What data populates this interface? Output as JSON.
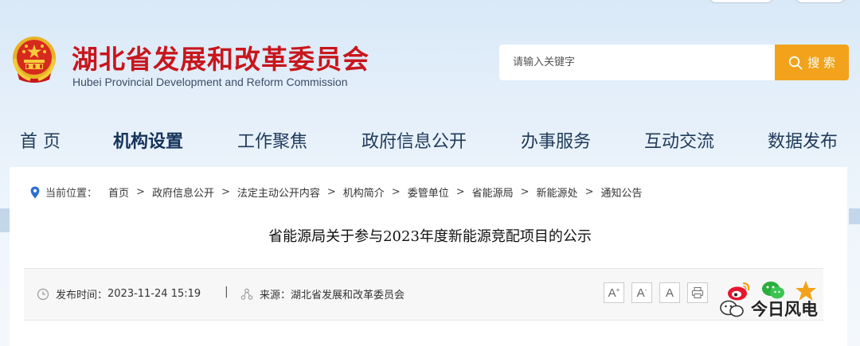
{
  "header": {
    "title_cn": "湖北省发展和改革委员会",
    "title_en": "Hubei Provincial Development and Reform Commission"
  },
  "search": {
    "placeholder": "请输入关键字",
    "button_label": "搜 索"
  },
  "nav": {
    "items": [
      {
        "label": "首 页"
      },
      {
        "label": "机构设置"
      },
      {
        "label": "工作聚焦"
      },
      {
        "label": "政府信息公开"
      },
      {
        "label": "办事服务"
      },
      {
        "label": "互动交流"
      },
      {
        "label": "数据发布"
      }
    ]
  },
  "breadcrumb": {
    "label": "当前位置：",
    "separator": ">",
    "items": [
      "首页",
      "政府信息公开",
      "法定主动公开内容",
      "机构简介",
      "委管单位",
      "省能源局",
      "新能源处",
      "通知公告"
    ]
  },
  "article": {
    "title": "省能源局关于参与2023年度新能源竞配项目的公示"
  },
  "meta": {
    "publish_label": "发布时间：",
    "publish_time": "2023-11-24 15:19",
    "separator": "|",
    "source_label": "来源：",
    "source": "湖北省发展和改革委员会"
  },
  "font_controls": {
    "larger": "A",
    "smaller": "A",
    "default": "A",
    "larger_mark": "+",
    "smaller_mark": "-"
  },
  "watermark": {
    "text": "今日风电"
  },
  "colors": {
    "brand_red": "#c8161d",
    "search_orange": "#f2a31b",
    "nav_text": "#1f3a5a"
  }
}
